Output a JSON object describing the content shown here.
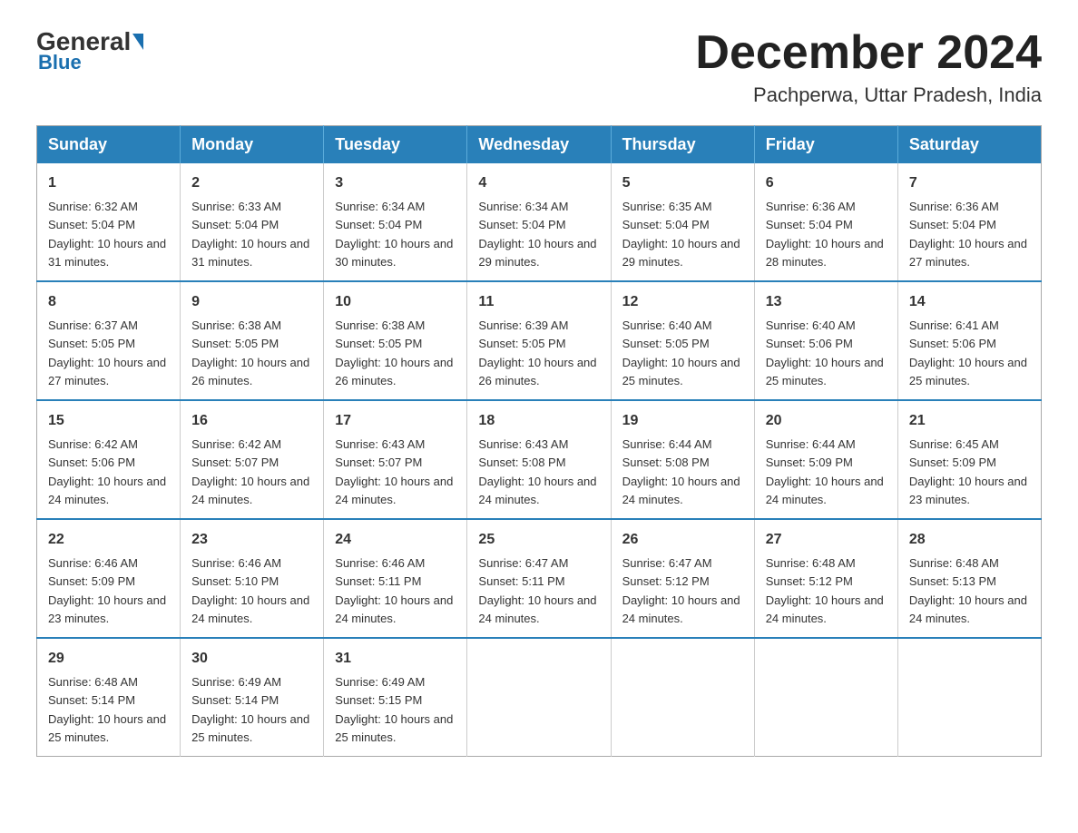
{
  "header": {
    "logo_general": "General",
    "logo_blue": "Blue",
    "month_title": "December 2024",
    "location": "Pachperwa, Uttar Pradesh, India"
  },
  "weekdays": [
    "Sunday",
    "Monday",
    "Tuesday",
    "Wednesday",
    "Thursday",
    "Friday",
    "Saturday"
  ],
  "weeks": [
    [
      {
        "day": "1",
        "sunrise": "6:32 AM",
        "sunset": "5:04 PM",
        "daylight": "10 hours and 31 minutes."
      },
      {
        "day": "2",
        "sunrise": "6:33 AM",
        "sunset": "5:04 PM",
        "daylight": "10 hours and 31 minutes."
      },
      {
        "day": "3",
        "sunrise": "6:34 AM",
        "sunset": "5:04 PM",
        "daylight": "10 hours and 30 minutes."
      },
      {
        "day": "4",
        "sunrise": "6:34 AM",
        "sunset": "5:04 PM",
        "daylight": "10 hours and 29 minutes."
      },
      {
        "day": "5",
        "sunrise": "6:35 AM",
        "sunset": "5:04 PM",
        "daylight": "10 hours and 29 minutes."
      },
      {
        "day": "6",
        "sunrise": "6:36 AM",
        "sunset": "5:04 PM",
        "daylight": "10 hours and 28 minutes."
      },
      {
        "day": "7",
        "sunrise": "6:36 AM",
        "sunset": "5:04 PM",
        "daylight": "10 hours and 27 minutes."
      }
    ],
    [
      {
        "day": "8",
        "sunrise": "6:37 AM",
        "sunset": "5:05 PM",
        "daylight": "10 hours and 27 minutes."
      },
      {
        "day": "9",
        "sunrise": "6:38 AM",
        "sunset": "5:05 PM",
        "daylight": "10 hours and 26 minutes."
      },
      {
        "day": "10",
        "sunrise": "6:38 AM",
        "sunset": "5:05 PM",
        "daylight": "10 hours and 26 minutes."
      },
      {
        "day": "11",
        "sunrise": "6:39 AM",
        "sunset": "5:05 PM",
        "daylight": "10 hours and 26 minutes."
      },
      {
        "day": "12",
        "sunrise": "6:40 AM",
        "sunset": "5:05 PM",
        "daylight": "10 hours and 25 minutes."
      },
      {
        "day": "13",
        "sunrise": "6:40 AM",
        "sunset": "5:06 PM",
        "daylight": "10 hours and 25 minutes."
      },
      {
        "day": "14",
        "sunrise": "6:41 AM",
        "sunset": "5:06 PM",
        "daylight": "10 hours and 25 minutes."
      }
    ],
    [
      {
        "day": "15",
        "sunrise": "6:42 AM",
        "sunset": "5:06 PM",
        "daylight": "10 hours and 24 minutes."
      },
      {
        "day": "16",
        "sunrise": "6:42 AM",
        "sunset": "5:07 PM",
        "daylight": "10 hours and 24 minutes."
      },
      {
        "day": "17",
        "sunrise": "6:43 AM",
        "sunset": "5:07 PM",
        "daylight": "10 hours and 24 minutes."
      },
      {
        "day": "18",
        "sunrise": "6:43 AM",
        "sunset": "5:08 PM",
        "daylight": "10 hours and 24 minutes."
      },
      {
        "day": "19",
        "sunrise": "6:44 AM",
        "sunset": "5:08 PM",
        "daylight": "10 hours and 24 minutes."
      },
      {
        "day": "20",
        "sunrise": "6:44 AM",
        "sunset": "5:09 PM",
        "daylight": "10 hours and 24 minutes."
      },
      {
        "day": "21",
        "sunrise": "6:45 AM",
        "sunset": "5:09 PM",
        "daylight": "10 hours and 23 minutes."
      }
    ],
    [
      {
        "day": "22",
        "sunrise": "6:46 AM",
        "sunset": "5:09 PM",
        "daylight": "10 hours and 23 minutes."
      },
      {
        "day": "23",
        "sunrise": "6:46 AM",
        "sunset": "5:10 PM",
        "daylight": "10 hours and 24 minutes."
      },
      {
        "day": "24",
        "sunrise": "6:46 AM",
        "sunset": "5:11 PM",
        "daylight": "10 hours and 24 minutes."
      },
      {
        "day": "25",
        "sunrise": "6:47 AM",
        "sunset": "5:11 PM",
        "daylight": "10 hours and 24 minutes."
      },
      {
        "day": "26",
        "sunrise": "6:47 AM",
        "sunset": "5:12 PM",
        "daylight": "10 hours and 24 minutes."
      },
      {
        "day": "27",
        "sunrise": "6:48 AM",
        "sunset": "5:12 PM",
        "daylight": "10 hours and 24 minutes."
      },
      {
        "day": "28",
        "sunrise": "6:48 AM",
        "sunset": "5:13 PM",
        "daylight": "10 hours and 24 minutes."
      }
    ],
    [
      {
        "day": "29",
        "sunrise": "6:48 AM",
        "sunset": "5:14 PM",
        "daylight": "10 hours and 25 minutes."
      },
      {
        "day": "30",
        "sunrise": "6:49 AM",
        "sunset": "5:14 PM",
        "daylight": "10 hours and 25 minutes."
      },
      {
        "day": "31",
        "sunrise": "6:49 AM",
        "sunset": "5:15 PM",
        "daylight": "10 hours and 25 minutes."
      },
      null,
      null,
      null,
      null
    ]
  ]
}
